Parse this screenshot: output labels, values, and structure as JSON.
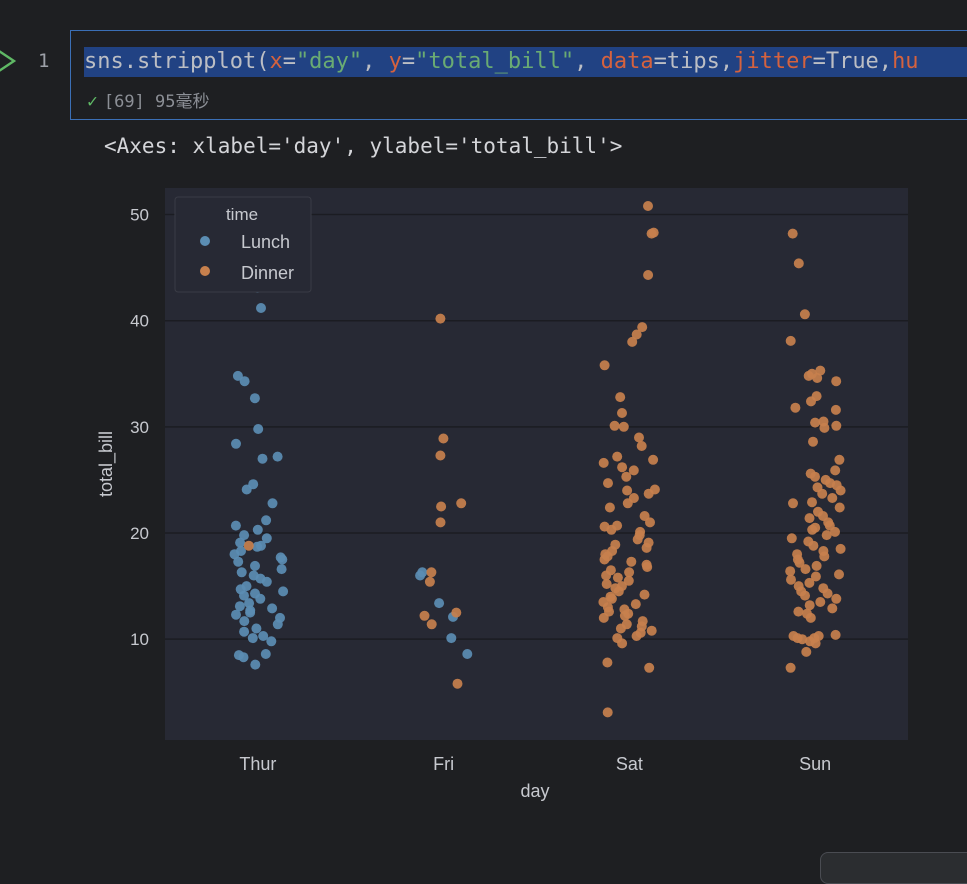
{
  "cell": {
    "line_number": "1",
    "code_tokens": [
      {
        "t": "sns.stripplot(",
        "c": "c-fn"
      },
      {
        "t": "x",
        "c": "c-kw"
      },
      {
        "t": "=",
        "c": "c-op"
      },
      {
        "t": "\"day\"",
        "c": "c-str"
      },
      {
        "t": ", ",
        "c": "c-op"
      },
      {
        "t": "y",
        "c": "c-kw"
      },
      {
        "t": "=",
        "c": "c-op"
      },
      {
        "t": "\"total_bill\"",
        "c": "c-str"
      },
      {
        "t": ", ",
        "c": "c-op"
      },
      {
        "t": "data",
        "c": "c-kw"
      },
      {
        "t": "=tips,",
        "c": "c-op"
      },
      {
        "t": "jitter",
        "c": "c-kw"
      },
      {
        "t": "=True,",
        "c": "c-op"
      },
      {
        "t": "hu",
        "c": "c-kw"
      }
    ],
    "status_count": "[69]",
    "status_time": "95毫秒"
  },
  "output_text": "<Axes: xlabel='day', ylabel='total_bill'>",
  "colors": {
    "lunch": "#5b8db3",
    "dinner": "#c7804d",
    "axes_bg": "#272934",
    "grid": "#1b1c22",
    "text": "#c7c9cf"
  },
  "chart_data": {
    "type": "scatter",
    "xlabel": "day",
    "ylabel": "total_bill",
    "categories": [
      "Thur",
      "Fri",
      "Sat",
      "Sun"
    ],
    "ylim": [
      0.5,
      52.5
    ],
    "yticks": [
      10,
      20,
      30,
      40,
      50
    ],
    "grid": true,
    "legend": {
      "title": "time",
      "placement": "top-left",
      "entries": [
        "Lunch",
        "Dinner"
      ]
    },
    "series": [
      {
        "name": "Lunch",
        "points": [
          [
            "Thur",
            43.1
          ],
          [
            "Thur",
            41.2
          ],
          [
            "Thur",
            34.8
          ],
          [
            "Thur",
            34.3
          ],
          [
            "Thur",
            32.7
          ],
          [
            "Thur",
            29.8
          ],
          [
            "Thur",
            28.4
          ],
          [
            "Thur",
            27.2
          ],
          [
            "Thur",
            27.0
          ],
          [
            "Thur",
            24.6
          ],
          [
            "Thur",
            24.1
          ],
          [
            "Thur",
            22.8
          ],
          [
            "Thur",
            21.2
          ],
          [
            "Thur",
            20.7
          ],
          [
            "Thur",
            20.3
          ],
          [
            "Thur",
            19.8
          ],
          [
            "Thur",
            19.5
          ],
          [
            "Thur",
            19.1
          ],
          [
            "Thur",
            18.8
          ],
          [
            "Thur",
            18.7
          ],
          [
            "Thur",
            18.3
          ],
          [
            "Thur",
            18.0
          ],
          [
            "Thur",
            17.7
          ],
          [
            "Thur",
            17.5
          ],
          [
            "Thur",
            17.3
          ],
          [
            "Thur",
            16.9
          ],
          [
            "Thur",
            16.6
          ],
          [
            "Thur",
            16.3
          ],
          [
            "Thur",
            16.0
          ],
          [
            "Thur",
            15.7
          ],
          [
            "Thur",
            15.4
          ],
          [
            "Thur",
            15.0
          ],
          [
            "Thur",
            14.7
          ],
          [
            "Thur",
            14.5
          ],
          [
            "Thur",
            14.3
          ],
          [
            "Thur",
            14.1
          ],
          [
            "Thur",
            13.8
          ],
          [
            "Thur",
            13.4
          ],
          [
            "Thur",
            13.1
          ],
          [
            "Thur",
            12.9
          ],
          [
            "Thur",
            12.7
          ],
          [
            "Thur",
            12.5
          ],
          [
            "Thur",
            12.3
          ],
          [
            "Thur",
            12.0
          ],
          [
            "Thur",
            11.7
          ],
          [
            "Thur",
            11.4
          ],
          [
            "Thur",
            11.0
          ],
          [
            "Thur",
            10.7
          ],
          [
            "Thur",
            10.3
          ],
          [
            "Thur",
            10.1
          ],
          [
            "Thur",
            9.8
          ],
          [
            "Thur",
            8.6
          ],
          [
            "Thur",
            8.5
          ],
          [
            "Thur",
            8.3
          ],
          [
            "Thur",
            7.6
          ],
          [
            "Fri",
            16.3
          ],
          [
            "Fri",
            16.0
          ],
          [
            "Fri",
            13.4
          ],
          [
            "Fri",
            12.1
          ],
          [
            "Fri",
            10.1
          ],
          [
            "Fri",
            8.6
          ]
        ]
      },
      {
        "name": "Dinner",
        "points": [
          [
            "Thur",
            18.8
          ],
          [
            "Fri",
            40.2
          ],
          [
            "Fri",
            28.9
          ],
          [
            "Fri",
            27.3
          ],
          [
            "Fri",
            22.8
          ],
          [
            "Fri",
            22.5
          ],
          [
            "Fri",
            21.0
          ],
          [
            "Fri",
            16.3
          ],
          [
            "Fri",
            15.4
          ],
          [
            "Fri",
            12.5
          ],
          [
            "Fri",
            12.2
          ],
          [
            "Fri",
            11.4
          ],
          [
            "Fri",
            5.8
          ],
          [
            "Sat",
            50.8
          ],
          [
            "Sat",
            48.3
          ],
          [
            "Sat",
            48.2
          ],
          [
            "Sat",
            44.3
          ],
          [
            "Sat",
            39.4
          ],
          [
            "Sat",
            38.7
          ],
          [
            "Sat",
            38.0
          ],
          [
            "Sat",
            35.8
          ],
          [
            "Sat",
            32.8
          ],
          [
            "Sat",
            31.3
          ],
          [
            "Sat",
            30.1
          ],
          [
            "Sat",
            30.0
          ],
          [
            "Sat",
            29.0
          ],
          [
            "Sat",
            28.2
          ],
          [
            "Sat",
            27.2
          ],
          [
            "Sat",
            26.9
          ],
          [
            "Sat",
            26.6
          ],
          [
            "Sat",
            26.2
          ],
          [
            "Sat",
            25.9
          ],
          [
            "Sat",
            25.3
          ],
          [
            "Sat",
            24.7
          ],
          [
            "Sat",
            24.1
          ],
          [
            "Sat",
            24.0
          ],
          [
            "Sat",
            23.7
          ],
          [
            "Sat",
            23.3
          ],
          [
            "Sat",
            22.8
          ],
          [
            "Sat",
            22.4
          ],
          [
            "Sat",
            21.6
          ],
          [
            "Sat",
            21.0
          ],
          [
            "Sat",
            20.7
          ],
          [
            "Sat",
            20.6
          ],
          [
            "Sat",
            20.3
          ],
          [
            "Sat",
            20.1
          ],
          [
            "Sat",
            19.8
          ],
          [
            "Sat",
            19.4
          ],
          [
            "Sat",
            19.1
          ],
          [
            "Sat",
            18.9
          ],
          [
            "Sat",
            18.6
          ],
          [
            "Sat",
            18.3
          ],
          [
            "Sat",
            18.0
          ],
          [
            "Sat",
            17.8
          ],
          [
            "Sat",
            17.5
          ],
          [
            "Sat",
            17.3
          ],
          [
            "Sat",
            17.0
          ],
          [
            "Sat",
            16.8
          ],
          [
            "Sat",
            16.5
          ],
          [
            "Sat",
            16.3
          ],
          [
            "Sat",
            16.0
          ],
          [
            "Sat",
            15.8
          ],
          [
            "Sat",
            15.5
          ],
          [
            "Sat",
            15.2
          ],
          [
            "Sat",
            15.0
          ],
          [
            "Sat",
            14.8
          ],
          [
            "Sat",
            14.5
          ],
          [
            "Sat",
            14.2
          ],
          [
            "Sat",
            14.0
          ],
          [
            "Sat",
            13.8
          ],
          [
            "Sat",
            13.5
          ],
          [
            "Sat",
            13.3
          ],
          [
            "Sat",
            13.0
          ],
          [
            "Sat",
            12.8
          ],
          [
            "Sat",
            12.6
          ],
          [
            "Sat",
            12.4
          ],
          [
            "Sat",
            12.2
          ],
          [
            "Sat",
            12.0
          ],
          [
            "Sat",
            11.7
          ],
          [
            "Sat",
            11.4
          ],
          [
            "Sat",
            11.2
          ],
          [
            "Sat",
            11.0
          ],
          [
            "Sat",
            10.8
          ],
          [
            "Sat",
            10.6
          ],
          [
            "Sat",
            10.3
          ],
          [
            "Sat",
            10.1
          ],
          [
            "Sat",
            9.6
          ],
          [
            "Sat",
            7.8
          ],
          [
            "Sat",
            7.3
          ],
          [
            "Sat",
            3.1
          ],
          [
            "Sun",
            48.2
          ],
          [
            "Sun",
            45.4
          ],
          [
            "Sun",
            40.6
          ],
          [
            "Sun",
            38.1
          ],
          [
            "Sun",
            35.3
          ],
          [
            "Sun",
            35.0
          ],
          [
            "Sun",
            34.8
          ],
          [
            "Sun",
            34.6
          ],
          [
            "Sun",
            34.3
          ],
          [
            "Sun",
            32.9
          ],
          [
            "Sun",
            32.4
          ],
          [
            "Sun",
            31.8
          ],
          [
            "Sun",
            31.6
          ],
          [
            "Sun",
            30.5
          ],
          [
            "Sun",
            30.4
          ],
          [
            "Sun",
            30.1
          ],
          [
            "Sun",
            29.9
          ],
          [
            "Sun",
            28.6
          ],
          [
            "Sun",
            26.9
          ],
          [
            "Sun",
            25.9
          ],
          [
            "Sun",
            25.6
          ],
          [
            "Sun",
            25.3
          ],
          [
            "Sun",
            25.0
          ],
          [
            "Sun",
            24.7
          ],
          [
            "Sun",
            24.5
          ],
          [
            "Sun",
            24.3
          ],
          [
            "Sun",
            24.0
          ],
          [
            "Sun",
            23.7
          ],
          [
            "Sun",
            23.3
          ],
          [
            "Sun",
            22.9
          ],
          [
            "Sun",
            22.8
          ],
          [
            "Sun",
            22.4
          ],
          [
            "Sun",
            22.0
          ],
          [
            "Sun",
            21.6
          ],
          [
            "Sun",
            21.4
          ],
          [
            "Sun",
            21.0
          ],
          [
            "Sun",
            20.7
          ],
          [
            "Sun",
            20.5
          ],
          [
            "Sun",
            20.3
          ],
          [
            "Sun",
            20.1
          ],
          [
            "Sun",
            19.8
          ],
          [
            "Sun",
            19.5
          ],
          [
            "Sun",
            19.2
          ],
          [
            "Sun",
            18.8
          ],
          [
            "Sun",
            18.5
          ],
          [
            "Sun",
            18.3
          ],
          [
            "Sun",
            18.0
          ],
          [
            "Sun",
            17.8
          ],
          [
            "Sun",
            17.5
          ],
          [
            "Sun",
            17.2
          ],
          [
            "Sun",
            16.9
          ],
          [
            "Sun",
            16.6
          ],
          [
            "Sun",
            16.4
          ],
          [
            "Sun",
            16.1
          ],
          [
            "Sun",
            15.9
          ],
          [
            "Sun",
            15.6
          ],
          [
            "Sun",
            15.3
          ],
          [
            "Sun",
            15.0
          ],
          [
            "Sun",
            14.8
          ],
          [
            "Sun",
            14.5
          ],
          [
            "Sun",
            14.3
          ],
          [
            "Sun",
            14.1
          ],
          [
            "Sun",
            13.8
          ],
          [
            "Sun",
            13.5
          ],
          [
            "Sun",
            13.2
          ],
          [
            "Sun",
            12.9
          ],
          [
            "Sun",
            12.6
          ],
          [
            "Sun",
            12.4
          ],
          [
            "Sun",
            12.0
          ],
          [
            "Sun",
            10.4
          ],
          [
            "Sun",
            10.3
          ],
          [
            "Sun",
            10.3
          ],
          [
            "Sun",
            10.1
          ],
          [
            "Sun",
            10.1
          ],
          [
            "Sun",
            10.0
          ],
          [
            "Sun",
            9.8
          ],
          [
            "Sun",
            9.6
          ],
          [
            "Sun",
            8.8
          ],
          [
            "Sun",
            7.3
          ]
        ]
      }
    ]
  }
}
